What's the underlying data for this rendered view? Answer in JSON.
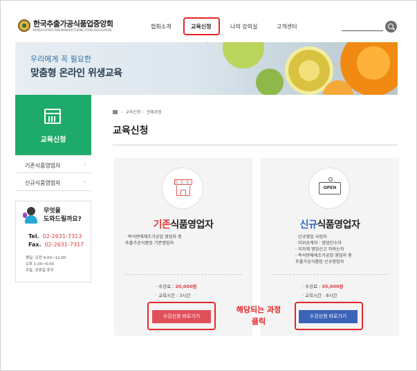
{
  "header": {
    "logo_title": "한국추출가공식품업중앙회",
    "logo_subtitle": "KOREA EXTRACTION MANUFACTURING FOOD ASSOCIATION",
    "nav": [
      "협회소개",
      "교육신청",
      "나의 강의실",
      "고객센터"
    ],
    "active_nav": "교육신청"
  },
  "annotations": {
    "click": "클릭",
    "course_line1": "해당되는 과정",
    "course_line2": "클릭",
    "color": "#e32626"
  },
  "banner": {
    "subtitle": "우리에게 꼭 필요한",
    "title": "맞춤형 온라인 위생교육"
  },
  "sidebar": {
    "title": "교육신청",
    "items": [
      {
        "label": "기존식품영업자",
        "chevron": "›"
      },
      {
        "label": "신규식품영업자",
        "chevron": "›"
      }
    ]
  },
  "help": {
    "question_line1": "무엇을",
    "question_line2": "도와드릴까요?",
    "tel_label": "Tel.",
    "tel": "02-2631-7313",
    "fax_label": "Fax.",
    "fax": "02-2631-7317",
    "hours": [
      "평일: 오전 9:00~12:00",
      "오후 1:00~6:00",
      "주말, 공휴일 휴무"
    ]
  },
  "breadcrumb": {
    "items": [
      "교육신청",
      "전체과정"
    ],
    "separator": "›"
  },
  "page_title": "교육신청",
  "cards": [
    {
      "title_accent": "기존",
      "title_rest": "식품영업자",
      "icon": "store-icon",
      "desc": [
        "· 즉석판매제조가공업 영업자 중",
        "추출가공식품업 기존영업자"
      ],
      "fee_label": "· 수강료 : ",
      "fee": "20,000원",
      "time": "· 교육시간 : 3시간",
      "button": "수강신청 바로가기",
      "accent_color": "#e0393e"
    },
    {
      "title_accent": "신규",
      "title_rest": "식품영업자",
      "icon": "open-sign-icon",
      "icon_text": "OPEN",
      "desc": [
        "· 신규영업 사업자",
        "· 지위승계자 · 영업인수자",
        "· 지자체 영업신고 하려는자",
        "· 즉석판매제조가공업 영업자 중",
        "추출가공식품업 신규영업자"
      ],
      "fee_label": "· 수강료 : ",
      "fee": "35,000원",
      "time": "· 교육시간 : 8시간",
      "button": "수강신청 바로가기",
      "accent_color": "#2c68c0"
    }
  ]
}
